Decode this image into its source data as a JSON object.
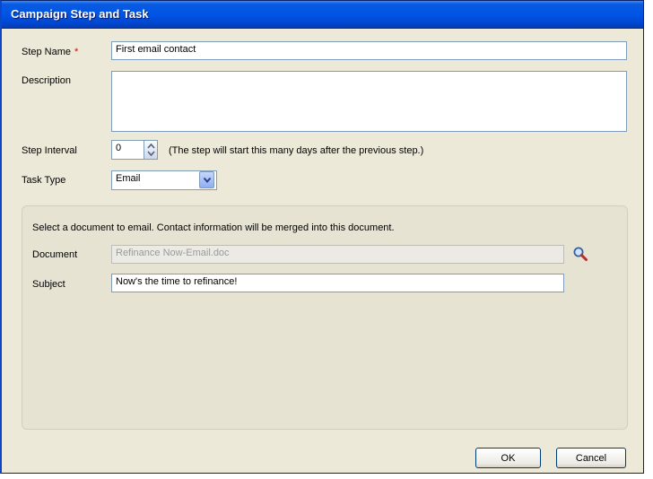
{
  "window": {
    "title": "Campaign Step and Task"
  },
  "fields": {
    "step_name": {
      "label": "Step Name",
      "required_marker": "*",
      "value": "First email contact"
    },
    "description": {
      "label": "Description",
      "value": ""
    },
    "step_interval": {
      "label": "Step Interval",
      "value": "0",
      "hint": "(The step will start this many days after the previous step.)"
    },
    "task_type": {
      "label": "Task Type",
      "selected": "Email"
    }
  },
  "email_group": {
    "instructions": "Select a document to email. Contact information will be merged into this document.",
    "document": {
      "label": "Document",
      "value": "Refinance Now-Email.doc"
    },
    "subject": {
      "label": "Subject",
      "value": "Now's the time to refinance!"
    }
  },
  "buttons": {
    "ok": "OK",
    "cancel": "Cancel"
  },
  "icons": {
    "browse": "magnifier-icon",
    "spin_up": "chevron-up-icon",
    "spin_down": "chevron-down-icon",
    "select": "chevron-down-icon"
  },
  "colors": {
    "title_bar": "#0055e5",
    "window_bg": "#ece9d8",
    "required": "#d00000"
  }
}
